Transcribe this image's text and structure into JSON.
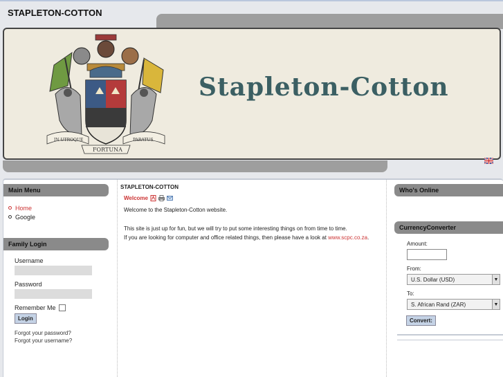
{
  "site": {
    "title": "STAPLETON-COTTON",
    "banner_text": "Stapleton-Cotton",
    "motto_left": "IN UTROQUE",
    "motto_right": "PARATUS",
    "motto_bottom": "FORTUNA"
  },
  "main_menu": {
    "title": "Main Menu",
    "items": [
      {
        "label": "Home",
        "active": true
      },
      {
        "label": "Google",
        "active": false
      }
    ]
  },
  "family_login": {
    "title": "Family Login",
    "username_label": "Username",
    "password_label": "Password",
    "remember_label": "Remember Me",
    "login_button": "Login",
    "forgot_password": "Forgot your password?",
    "forgot_username": "Forgot your username?"
  },
  "article": {
    "section_title": "STAPLETON-COTTON",
    "heading": "Welcome",
    "intro": "Welcome to the Stapleton-Cotton website.",
    "para1": "This site is just up for fun, but we will try to put some interesting things on from time to time.",
    "para2_prefix": "If you are looking for computer and office related things, then please have a look at ",
    "para2_link": "www.scpc.co.za",
    "para2_suffix": "."
  },
  "whos_online": {
    "title": "Who's Online"
  },
  "currency": {
    "title": "CurrencyConverter",
    "amount_label": "Amount:",
    "from_label": "From:",
    "from_value": "U.S. Dollar (USD)",
    "to_label": "To:",
    "to_value": "S. African Rand (ZAR)",
    "convert_button": "Convert:"
  },
  "colors": {
    "accent_red": "#cc3333",
    "header_gray": "#8a8a8a",
    "banner_text": "#3b5f63"
  },
  "icons": [
    "pdf-icon",
    "print-icon",
    "email-icon",
    "uk-flag-icon"
  ]
}
